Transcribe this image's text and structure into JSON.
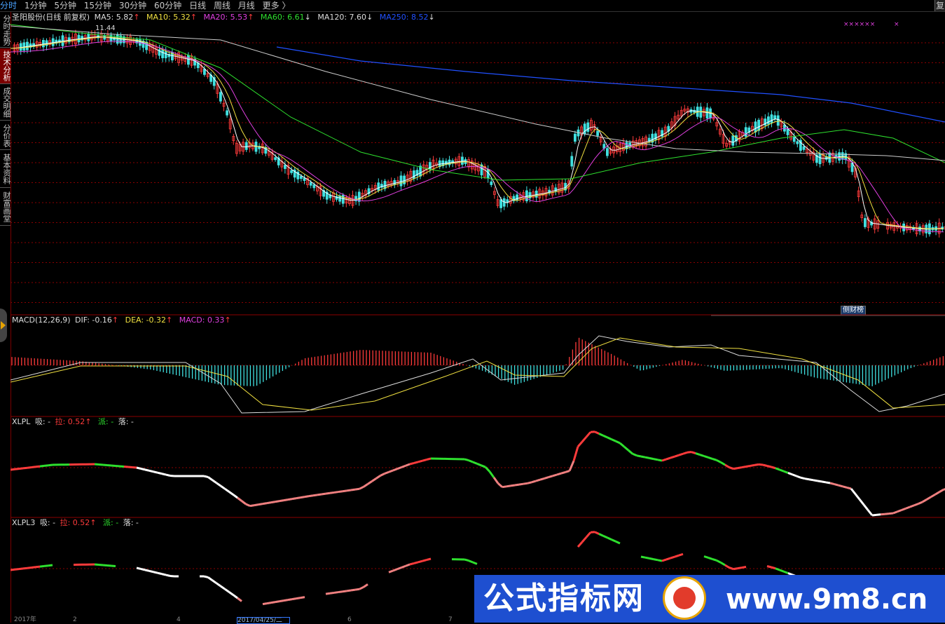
{
  "toolbar": {
    "tabs": [
      {
        "label": "分时",
        "active": true
      },
      {
        "label": "1分钟"
      },
      {
        "label": "5分钟"
      },
      {
        "label": "15分钟"
      },
      {
        "label": "30分钟"
      },
      {
        "label": "60分钟"
      },
      {
        "label": "日线"
      },
      {
        "label": "周线"
      },
      {
        "label": "月线"
      },
      {
        "label": "更多"
      }
    ],
    "more_arrow": "〉",
    "right_button": "复"
  },
  "sidebar": {
    "tabs": [
      {
        "label": "分时走势"
      },
      {
        "label": "技术分析",
        "active": true
      },
      {
        "label": "成交明细"
      },
      {
        "label": "分价表"
      },
      {
        "label": "基本资料"
      },
      {
        "label": "财富画堂"
      }
    ]
  },
  "main_panel": {
    "stock_name": "圣阳股份(日线 前复权)",
    "ma": [
      {
        "label": "MA5: 5.82",
        "arrow": "↑",
        "color": "#ffffff"
      },
      {
        "label": "MA10: 5.32",
        "arrow": "↑",
        "color": "#f0e040"
      },
      {
        "label": "MA20: 5.53",
        "arrow": "↑",
        "color": "#e040e0"
      },
      {
        "label": "MA60: 6.61",
        "arrow": "↓",
        "color": "#2ee02e"
      },
      {
        "label": "MA120: 7.60",
        "arrow": "↓",
        "color": "#cccccc"
      },
      {
        "label": "MA250: 8.52",
        "arrow": "↓",
        "color": "#2050ff"
      }
    ],
    "high_marker": "11.44",
    "x_markers": "××××××",
    "x_marker_single": "×"
  },
  "macd_panel": {
    "name": "MACD(12,26,9)",
    "dif": "DIF: -0.16",
    "dif_arrow": "↑",
    "dea": "DEA: -0.32",
    "dea_arrow": "↑",
    "macd": "MACD: 0.33",
    "macd_arrow": "↑",
    "hbutton": "侧财榜"
  },
  "xlpl_panel": {
    "name": "XLPL",
    "xi": "吸: -",
    "la": "拉: 0.52",
    "la_arrow": "↑",
    "pai": "派: -",
    "luo": "落: -"
  },
  "xlpl3_panel": {
    "name": "XLPL3",
    "xi": "吸: -",
    "la": "拉: 0.52",
    "la_arrow": "↑",
    "pai": "派: -",
    "luo": "落: -"
  },
  "bottom_axis": {
    "labels": [
      "2017年",
      "2",
      "4",
      "2017/04/25/二",
      "6",
      "7"
    ]
  },
  "watermark": {
    "text_left": "公式指标网",
    "text_right": "www.9m8.cn"
  },
  "colors": {
    "up": "#ff3b3b",
    "down": "#40e0e0",
    "ma5": "#ffffff",
    "ma10": "#f0e040",
    "ma20": "#e040e0",
    "ma60": "#2ee02e",
    "ma120": "#cccccc",
    "ma250": "#2050ff",
    "grid": "#8b0000"
  }
}
